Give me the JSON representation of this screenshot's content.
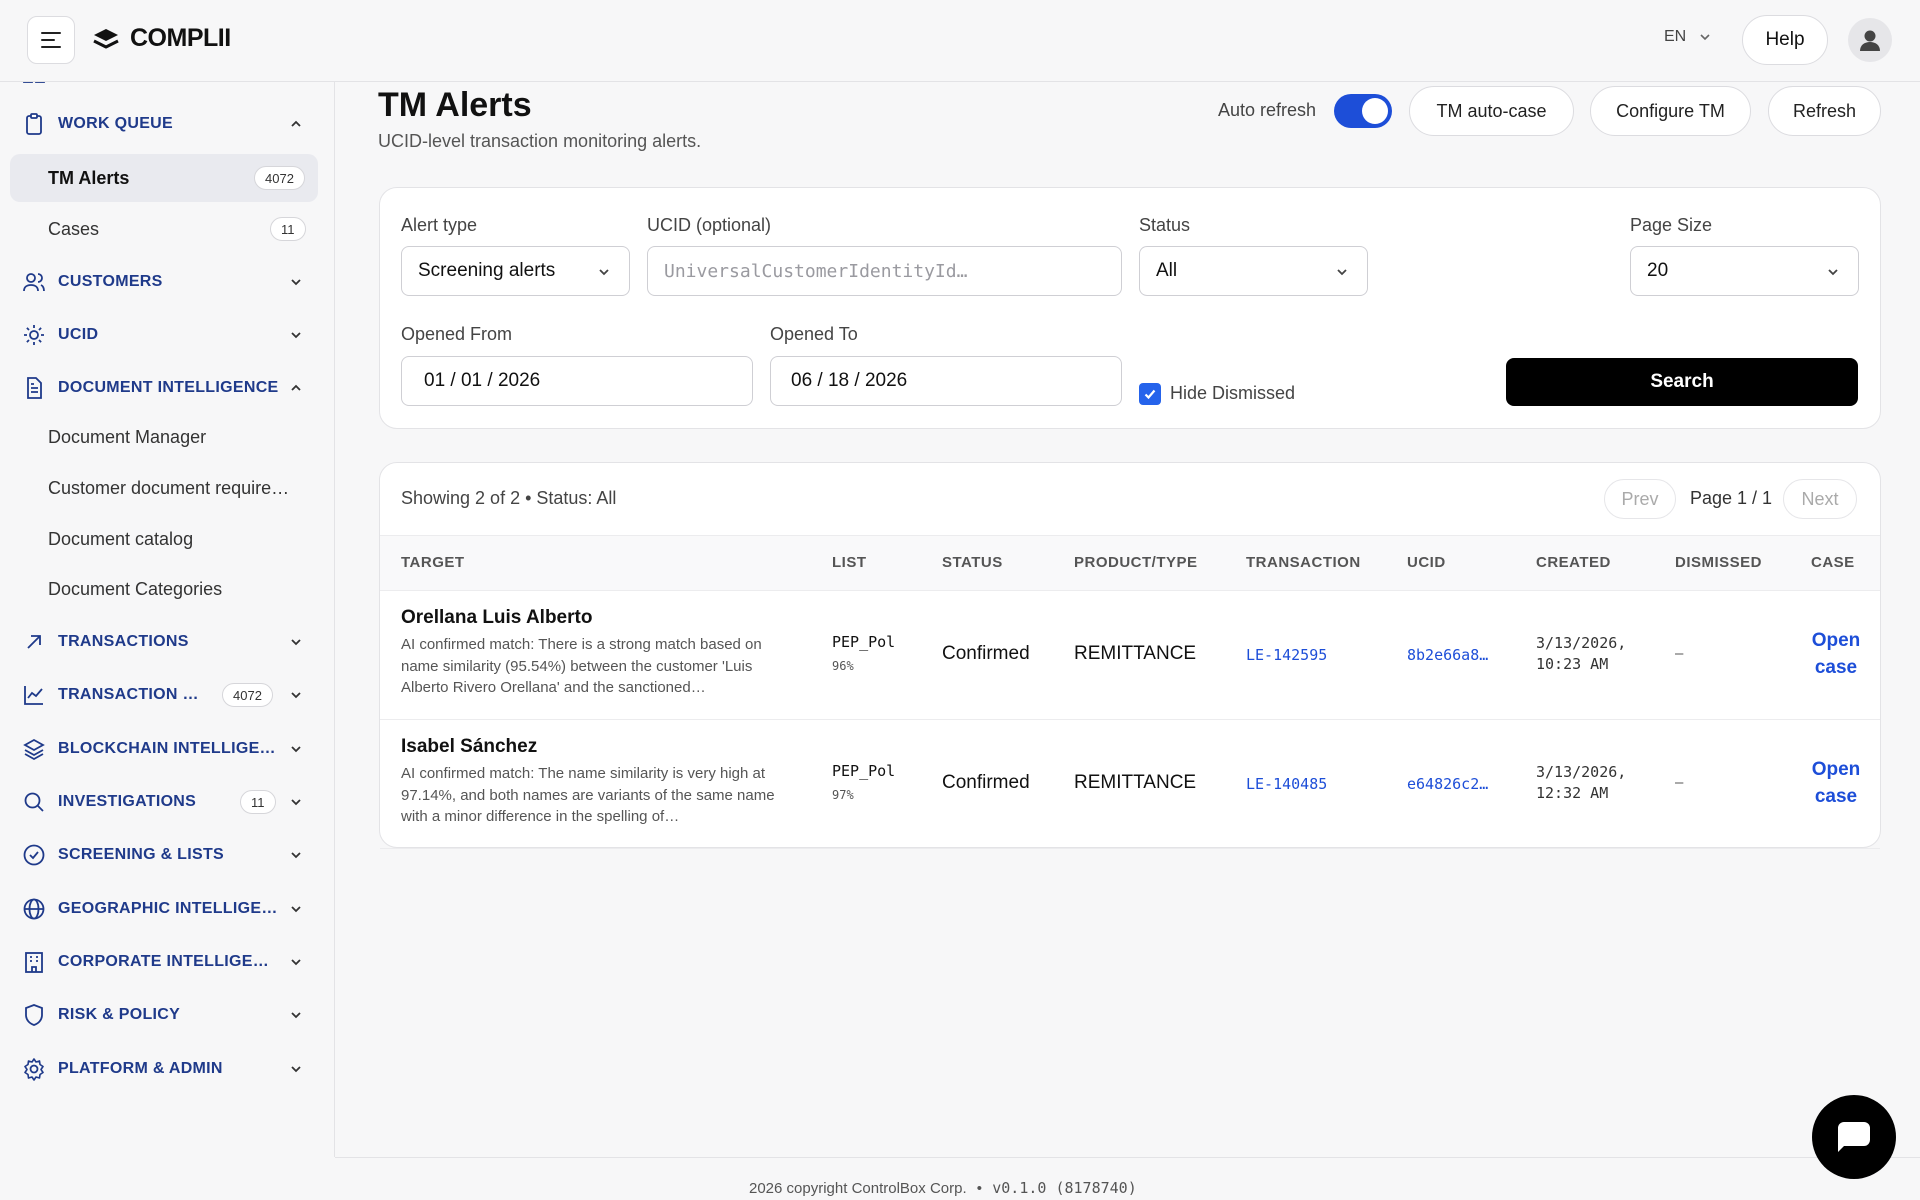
{
  "header": {
    "brand": "COMPLII",
    "language": "EN",
    "help_label": "Help"
  },
  "sidebar": {
    "work_queue": {
      "label": "WORK QUEUE"
    },
    "work_queue_items": [
      {
        "label": "TM Alerts",
        "badge": "4072",
        "active": true
      },
      {
        "label": "Cases",
        "badge": "11"
      }
    ],
    "customers": {
      "label": "CUSTOMERS"
    },
    "ucid": {
      "label": "UCID"
    },
    "document_intelligence": {
      "label": "DOCUMENT INTELLIGENCE"
    },
    "doc_items": [
      {
        "label": "Document Manager"
      },
      {
        "label": "Customer document require…"
      },
      {
        "label": "Document catalog"
      },
      {
        "label": "Document Categories"
      }
    ],
    "transactions": {
      "label": "TRANSACTIONS"
    },
    "transaction_monitoring": {
      "label": "TRANSACTION M…",
      "badge": "4072"
    },
    "blockchain": {
      "label": "BLOCKCHAIN INTELLIGEN…"
    },
    "investigations": {
      "label": "INVESTIGATIONS",
      "badge": "11"
    },
    "screening": {
      "label": "SCREENING & LISTS"
    },
    "geographic": {
      "label": "GEOGRAPHIC INTELLIGE…"
    },
    "corporate": {
      "label": "CORPORATE INTELLIGEN…"
    },
    "risk": {
      "label": "RISK & POLICY"
    },
    "platform": {
      "label": "PLATFORM & ADMIN"
    }
  },
  "page": {
    "title": "TM Alerts",
    "subtitle": "UCID-level transaction monitoring alerts.",
    "auto_refresh_label": "Auto refresh",
    "auto_refresh_on": true,
    "tm_auto_case_label": "TM auto-case",
    "configure_tm_label": "Configure TM",
    "refresh_label": "Refresh"
  },
  "filters": {
    "alert_type_label": "Alert type",
    "alert_type_value": "Screening alerts",
    "ucid_label": "UCID (optional)",
    "ucid_placeholder": "UniversalCustomerIdentityId…",
    "status_label": "Status",
    "status_value": "All",
    "page_size_label": "Page Size",
    "page_size_value": "20",
    "opened_from_label": "Opened From",
    "opened_from_value": "01 / 01 / 2026",
    "opened_to_label": "Opened To",
    "opened_to_value": "06 / 18 / 2026",
    "hide_dismissed_label": "Hide Dismissed",
    "hide_dismissed_checked": true,
    "search_label": "Search"
  },
  "results": {
    "summary": "Showing 2 of 2 • Status: All",
    "prev_label": "Prev",
    "page_label": "Page 1 / 1",
    "next_label": "Next",
    "columns": [
      "TARGET",
      "LIST",
      "STATUS",
      "PRODUCT/TYPE",
      "TRANSACTION",
      "UCID",
      "CREATED",
      "DISMISSED",
      "CASE"
    ],
    "rows": [
      {
        "target_name": "Orellana Luis Alberto",
        "target_desc": "AI confirmed match: There is a strong match based on name similarity (95.54%) between the customer 'Luis Alberto Rivero Orellana' and the sanctioned…",
        "list_code": "PEP_Pol",
        "list_pct": "96%",
        "status": "Confirmed",
        "product": "REMITTANCE",
        "transaction": "LE-142595",
        "ucid": "8b2e66a8…",
        "created_line1": "3/13/2026,",
        "created_line2": "10:23 AM",
        "dismissed": "–",
        "case_line1": "Open",
        "case_line2": "case"
      },
      {
        "target_name": "Isabel Sánchez",
        "target_desc": "AI confirmed match: The name similarity is very high at 97.14%, and both names are variants of the same name with a minor difference in the spelling of…",
        "list_code": "PEP_Pol",
        "list_pct": "97%",
        "status": "Confirmed",
        "product": "REMITTANCE",
        "transaction": "LE-140485",
        "ucid": "e64826c2…",
        "created_line1": "3/13/2026,",
        "created_line2": "12:32 AM",
        "dismissed": "–",
        "case_line1": "Open",
        "case_line2": "case"
      }
    ]
  },
  "footer": {
    "copyright": "2026 copyright ControlBox Corp.",
    "separator": "•",
    "version": "v0.1.0 (8178740)"
  },
  "colors": {
    "accent": "#1d4ed8",
    "nav_section": "#1f3a8a",
    "primary_button": "#000000"
  }
}
